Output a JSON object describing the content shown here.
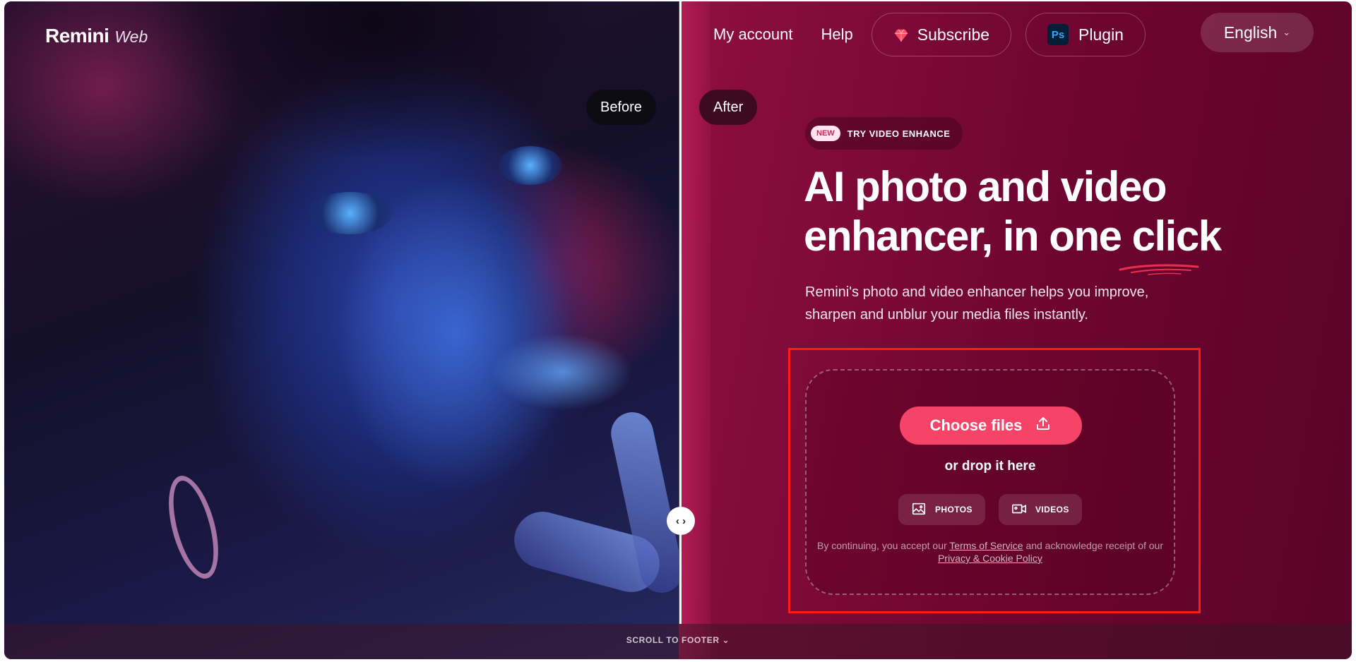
{
  "header": {
    "logo_main": "Remini",
    "logo_sub": "Web",
    "nav": {
      "my_account": "My account",
      "help": "Help",
      "subscribe": "Subscribe",
      "plugin": "Plugin",
      "plugin_icon_text": "Ps",
      "language": "English"
    }
  },
  "comparison": {
    "before_label": "Before",
    "after_label": "After"
  },
  "hero": {
    "badge_new": "NEW",
    "badge_text": "TRY VIDEO ENHANCE",
    "title_line1": "AI photo and video",
    "title_line2": "enhancer, in one click",
    "subtitle": "Remini's photo and video enhancer helps you improve, sharpen and unblur your media files instantly."
  },
  "upload": {
    "choose_files": "Choose files",
    "drop_text": "or drop it here",
    "photos_label": "PHOTOS",
    "videos_label": "VIDEOS",
    "legal_prefix": "By continuing, you accept our",
    "terms_link": "Terms of Service",
    "legal_mid": "and acknowledge receipt of our",
    "privacy_link": "Privacy & Cookie Policy"
  },
  "footer": {
    "scroll_to_footer": "SCROLL TO FOOTER"
  },
  "colors": {
    "accent": "#f54468",
    "background": "#8f0f42",
    "focus_outline": "#ff1a1a"
  }
}
